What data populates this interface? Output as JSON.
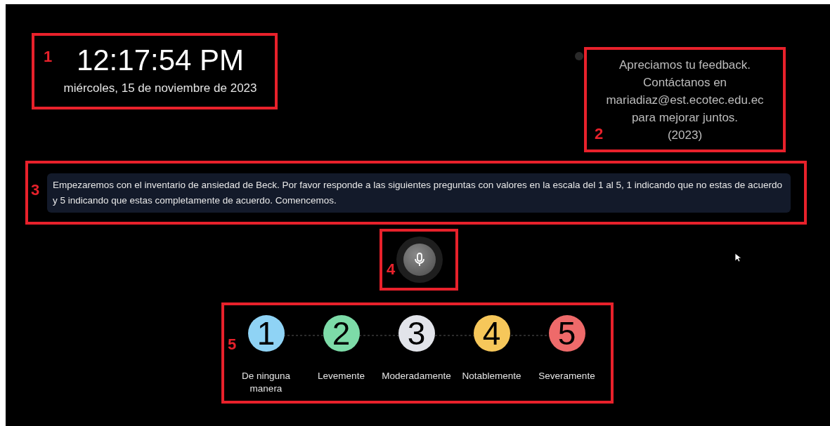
{
  "clock": {
    "time": "12:17:54 PM",
    "date": "miércoles, 15 de noviembre de 2023"
  },
  "feedback": {
    "lines": [
      "Apreciamos tu feedback.",
      "Contáctanos en",
      "mariadiaz@est.ecotec.edu.ec",
      "para mejorar juntos.",
      "(2023)"
    ]
  },
  "message": "Empezaremos con el inventario de ansiedad de Beck. Por favor responde a las siguientes preguntas con valores en la escala del 1 al 5, 1 indicando que no estas de acuerdo y 5 indicando que estas completamente de acuerdo. Comencemos.",
  "scale": [
    {
      "number": "1",
      "label": "De ninguna manera",
      "color": "#8fd3f5"
    },
    {
      "number": "2",
      "label": "Levemente",
      "color": "#7ddba8"
    },
    {
      "number": "3",
      "label": "Moderadamente",
      "color": "#e2e4ea"
    },
    {
      "number": "4",
      "label": "Notablemente",
      "color": "#f6c75a"
    },
    {
      "number": "5",
      "label": "Severamente",
      "color": "#ee6a6a"
    }
  ],
  "annotations": [
    "1",
    "2",
    "3",
    "4",
    "5"
  ]
}
